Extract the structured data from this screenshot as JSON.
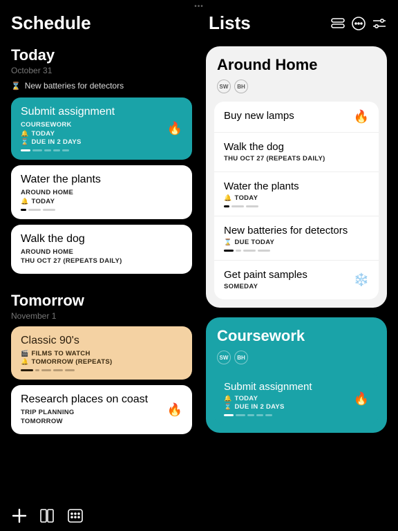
{
  "drag_dots": "•••",
  "schedule": {
    "title": "Schedule",
    "today": {
      "heading": "Today",
      "date": "October 31",
      "overdue": {
        "icon": "⌛",
        "text": "New batteries for detectors"
      },
      "cards": [
        {
          "style": "teal",
          "title": "Submit assignment",
          "sub": "COURSEWORK",
          "metas": [
            {
              "icon": "🔔",
              "text": "TODAY"
            },
            {
              "icon": "⌛",
              "text": "DUE IN 2 DAYS"
            }
          ],
          "icon": "🔥",
          "progress": [
            14,
            14,
            10,
            10,
            10
          ]
        },
        {
          "style": "white",
          "title": "Water the plants",
          "sub": "AROUND HOME",
          "metas": [
            {
              "icon": "🔔",
              "text": "TODAY"
            }
          ],
          "progress": [
            8,
            18,
            18
          ]
        },
        {
          "style": "white",
          "title": "Walk the dog",
          "sub": "AROUND HOME",
          "metas": [
            {
              "icon": "",
              "text": "THU OCT 27 (REPEATS DAILY)"
            }
          ]
        }
      ]
    },
    "tomorrow": {
      "heading": "Tomorrow",
      "date": "November 1",
      "cards": [
        {
          "style": "peach",
          "title": "Classic 90's",
          "sub": "",
          "metas": [
            {
              "icon": "🎬",
              "text": "FILMS TO WATCH"
            },
            {
              "icon": "🔔",
              "text": "TOMORROW (REPEATS)"
            }
          ],
          "progress": [
            18,
            6,
            14,
            14,
            14
          ]
        },
        {
          "style": "white",
          "title": "Research places on coast",
          "sub": "TRIP PLANNING",
          "metas": [
            {
              "icon": "",
              "text": "TOMORROW"
            }
          ],
          "icon": "🔥"
        }
      ]
    }
  },
  "lists": {
    "title": "Lists",
    "panels": [
      {
        "style": "light",
        "title": "Around Home",
        "avatars": [
          "SW",
          "BH"
        ],
        "items": [
          {
            "title": "Buy new lamps",
            "metas": [],
            "icon": "🔥"
          },
          {
            "title": "Walk the dog",
            "metas": [
              {
                "icon": "",
                "text": "THU OCT 27 (REPEATS DAILY)"
              }
            ]
          },
          {
            "title": "Water the plants",
            "metas": [
              {
                "icon": "🔔",
                "text": "TODAY"
              }
            ],
            "progress": [
              8,
              18,
              18
            ]
          },
          {
            "title": "New batteries for detectors",
            "metas": [
              {
                "icon": "⌛",
                "text": "DUE TODAY"
              }
            ],
            "progress": [
              14,
              8,
              18,
              18
            ]
          },
          {
            "title": "Get paint samples",
            "metas": [
              {
                "icon": "",
                "text": "SOMEDAY"
              }
            ],
            "icon": "❄️"
          }
        ]
      },
      {
        "style": "teal",
        "title": "Coursework",
        "avatars": [
          "SW",
          "BH"
        ],
        "items": [
          {
            "title": "Submit assignment",
            "metas": [
              {
                "icon": "🔔",
                "text": "TODAY"
              },
              {
                "icon": "⌛",
                "text": "DUE IN 2 DAYS"
              }
            ],
            "icon": "🔥",
            "teal": true,
            "progress": [
              14,
              14,
              10,
              10,
              10
            ]
          }
        ]
      }
    ]
  }
}
